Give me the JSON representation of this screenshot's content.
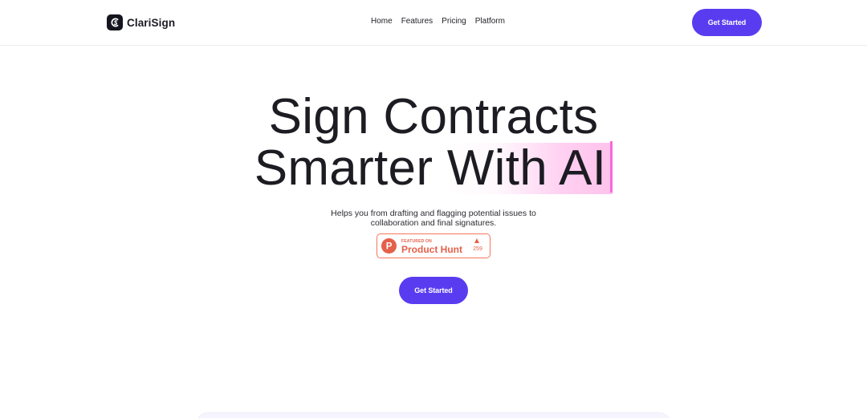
{
  "brand": {
    "name": "ClariSign",
    "icon": "clarisign-logo-icon"
  },
  "nav": {
    "links": [
      {
        "label": "Home"
      },
      {
        "label": "Features"
      },
      {
        "label": "Pricing"
      },
      {
        "label": "Platform"
      }
    ],
    "cta_label": "Get Started"
  },
  "hero": {
    "title_line1": "Sign Contracts",
    "title_line2_prefix": "Smarter ",
    "title_line2_highlight": "With AI",
    "subtitle_line1": "Helps you from drafting and flagging potential issues to",
    "subtitle_line2": "collaboration and final signatures.",
    "cta_label": "Get Started"
  },
  "product_hunt": {
    "kicker": "FEATURED ON",
    "name": "Product Hunt",
    "logo_letter": "P",
    "count": "259",
    "icon": "upvote-arrow-icon"
  },
  "colors": {
    "accent": "#5a3cf0",
    "product_hunt": "#e5604a",
    "highlight": "#ffc2ec",
    "caret": "#f56ad8"
  }
}
